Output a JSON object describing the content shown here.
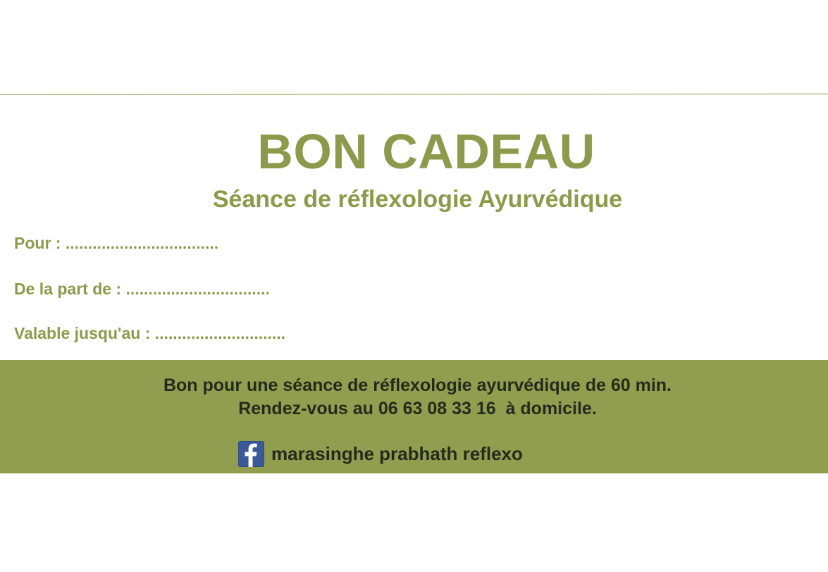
{
  "voucher": {
    "title": "BON CADEAU",
    "subtitle": "Séance de réflexologie Ayurvédique",
    "fields": {
      "pour": "Pour : ..................................",
      "de_la_part": "De la part de : ................................",
      "valable": "Valable jusqu'au : ............................."
    },
    "band": {
      "line1": "Bon pour une séance de réflexologie ayurvédique de 60 min.",
      "line2": "Rendez-vous au 06 63 08 33 16  à domicile.",
      "social_icon": "facebook-icon",
      "social_handle": "marasinghe prabhath reflexo"
    }
  },
  "colors": {
    "accent": "#8b9a4b",
    "band": "#929e4f",
    "band_text": "#262a1c",
    "facebook": "#3b5998"
  }
}
